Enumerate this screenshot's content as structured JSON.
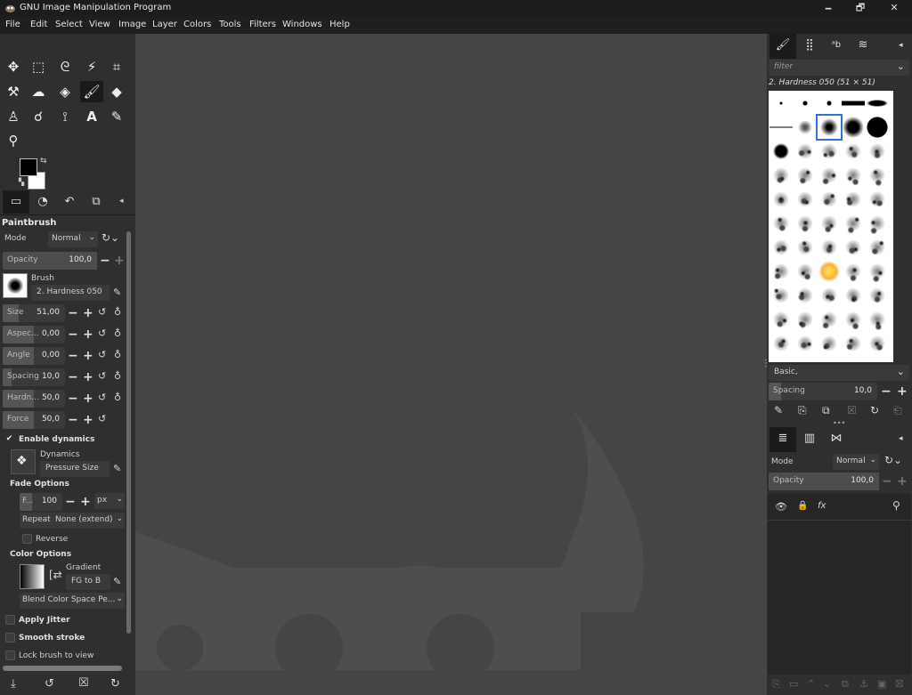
{
  "window": {
    "title": "GNU Image Manipulation Program",
    "minimize": "🗕",
    "maximize": "🗗",
    "close": "✕"
  },
  "menu": [
    "File",
    "Edit",
    "Select",
    "View",
    "Image",
    "Layer",
    "Colors",
    "Tools",
    "Filters",
    "Windows",
    "Help"
  ],
  "toolbox": {
    "tools": [
      "move-icon",
      "rect-select-icon",
      "lasso-icon",
      "fuzzy-select-icon",
      "crop-icon",
      "warp-icon",
      "smudge-icon",
      "bucket-fill-icon",
      "paintbrush-icon",
      "eraser-icon",
      "clone-icon",
      "dodge-icon",
      "path-icon",
      "text-icon",
      "color-picker-icon",
      "zoom-icon"
    ],
    "fg_color": "#000000",
    "bg_color": "#ffffff"
  },
  "tool_options": {
    "title": "Paintbrush",
    "mode_label": "Mode",
    "mode_value": "Normal",
    "opacity_label": "Opacity",
    "opacity_value": "100,0",
    "brush_label": "Brush",
    "brush_name": "2. Hardness 050",
    "size_label": "Size",
    "size_value": "51,00",
    "aspect_label": "Aspec...",
    "aspect_value": "0,00",
    "angle_label": "Angle",
    "angle_value": "0,00",
    "spacing_label": "Spacing",
    "spacing_value": "10,0",
    "hardness_label": "Hardn...",
    "hardness_value": "50,0",
    "force_label": "Force",
    "force_value": "50,0",
    "enable_dynamics": "Enable dynamics",
    "dynamics_label": "Dynamics",
    "dynamics_value": "Pressure Size",
    "fade_options": "Fade Options",
    "fade_label": "F...",
    "fade_value": "100",
    "fade_unit": "px",
    "repeat_label": "Repeat",
    "repeat_value": "None (extend)",
    "reverse": "Reverse",
    "color_options": "Color Options",
    "gradient_label": "Gradient",
    "gradient_value": "FG to B",
    "blend_value": "Blend Color Space Pe...",
    "apply_jitter": "Apply Jitter",
    "smooth_stroke": "Smooth stroke",
    "lock_brush": "Lock brush to view"
  },
  "brushes": {
    "filter_placeholder": "filter",
    "current": "2. Hardness 050 (51 × 51)",
    "preset": "Basic,",
    "spacing_label": "Spacing",
    "spacing_value": "10,0"
  },
  "layers": {
    "mode_label": "Mode",
    "mode_value": "Normal",
    "opacity_label": "Opacity",
    "opacity_value": "100,0"
  }
}
